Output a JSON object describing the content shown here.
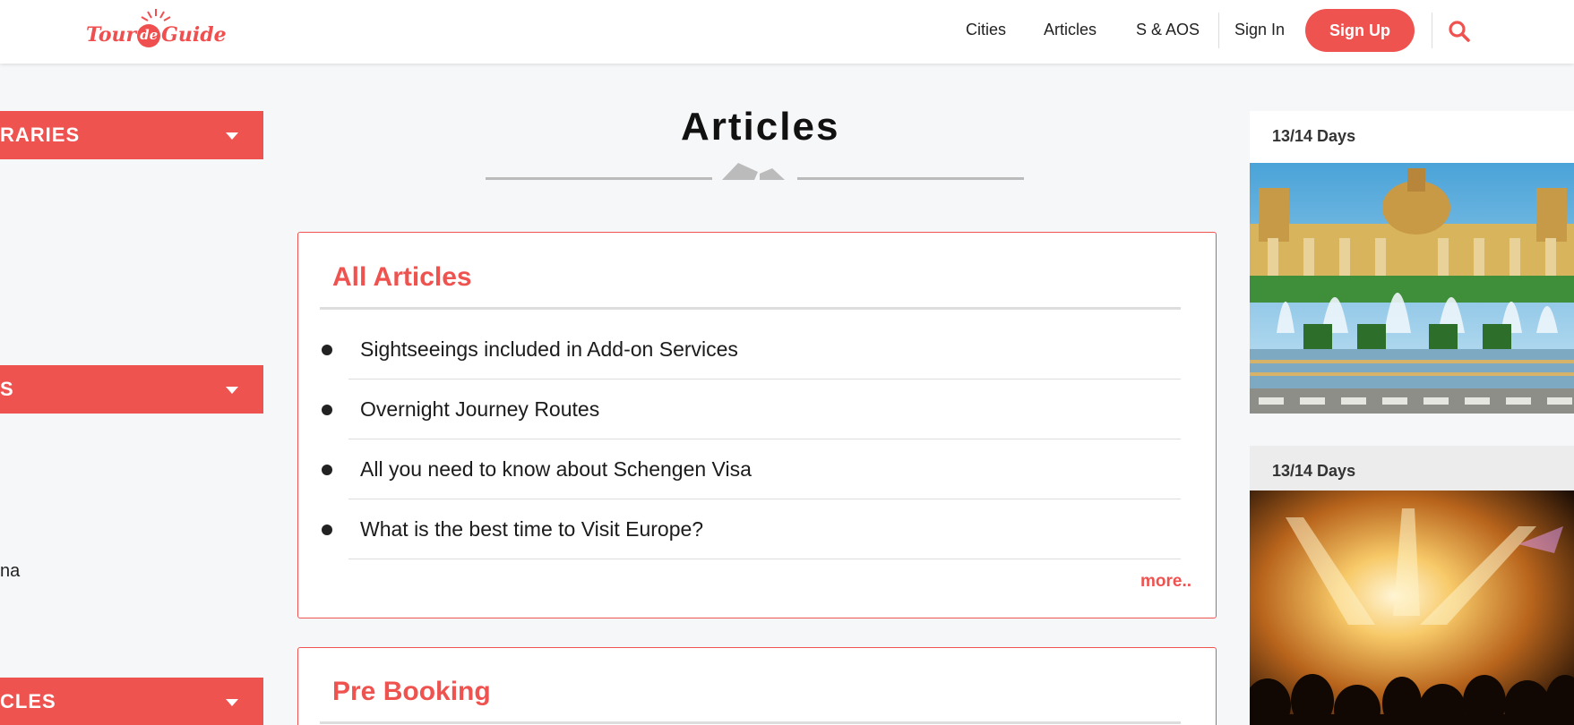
{
  "header": {
    "logo": {
      "part1": "Tour",
      "part2": "de",
      "part3": "Guide"
    },
    "nav": [
      {
        "label": "Cities"
      },
      {
        "label": "Articles"
      },
      {
        "label": "S & AOS"
      },
      {
        "label": "Sign In"
      }
    ],
    "signup_label": "Sign Up",
    "accent": "#ef5350"
  },
  "sidebar": {
    "bars": [
      {
        "label": "RARIES"
      },
      {
        "label": "S"
      },
      {
        "label": "CLES"
      }
    ],
    "text": "na"
  },
  "main": {
    "title": "Articles",
    "cards": [
      {
        "title": "All Articles",
        "items": [
          "Sightseeings included in Add-on Services",
          "Overnight Journey Routes",
          "All you need to know about Schengen Visa",
          "What is the best time to Visit Europe?"
        ],
        "more_label": "more.."
      },
      {
        "title": "Pre Booking"
      }
    ]
  },
  "promos": [
    {
      "days": "13/14 Days",
      "icon": "palace-fountain-image"
    },
    {
      "days": "13/14 Days",
      "icon": "concert-crowd-image"
    }
  ]
}
